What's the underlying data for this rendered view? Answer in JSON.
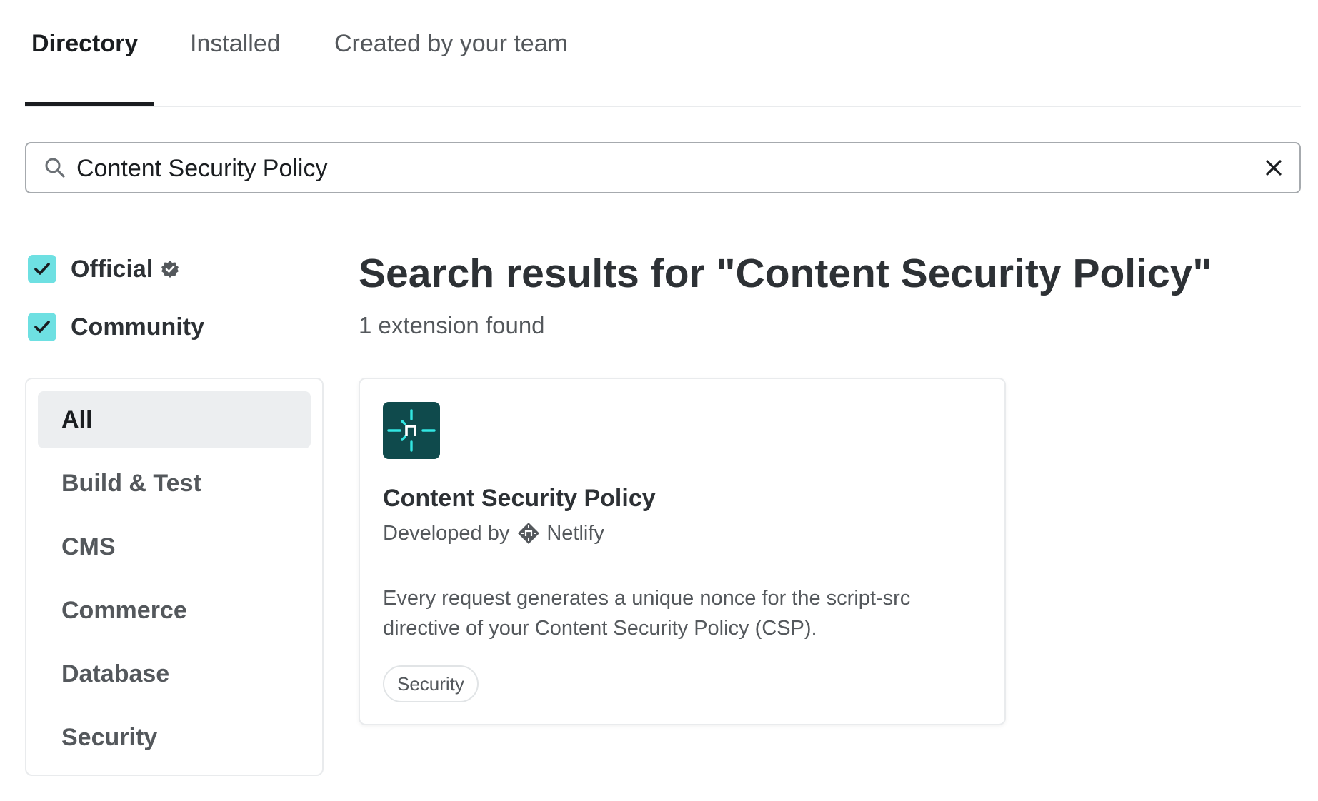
{
  "tabs": [
    {
      "label": "Directory",
      "active": true
    },
    {
      "label": "Installed",
      "active": false
    },
    {
      "label": "Created by your team",
      "active": false
    }
  ],
  "search": {
    "value": "Content Security Policy",
    "icon": "search-icon",
    "clear_icon": "close-icon"
  },
  "filters": [
    {
      "label": "Official",
      "checked": true,
      "badge_icon": "verified-badge-icon"
    },
    {
      "label": "Community",
      "checked": true
    }
  ],
  "categories": [
    {
      "label": "All",
      "active": true
    },
    {
      "label": "Build & Test",
      "active": false
    },
    {
      "label": "CMS",
      "active": false
    },
    {
      "label": "Commerce",
      "active": false
    },
    {
      "label": "Database",
      "active": false
    },
    {
      "label": "Security",
      "active": false
    }
  ],
  "results": {
    "title": "Search results for \"Content Security Policy\"",
    "count": "1 extension found"
  },
  "extension": {
    "logo_icon": "netlify-logo-icon",
    "title": "Content Security Policy",
    "developed_by_label": "Developed by",
    "developer": "Netlify",
    "description": "Every request generates a unique nonce for the script-src directive of your Content Security Policy (CSP).",
    "tag": "Security"
  },
  "colors": {
    "accent_checkbox": "#6ee0e2",
    "logo_bg": "#0f4a4c",
    "logo_mark": "#32e6e2",
    "active_tab_underline": "#1a1d20"
  }
}
